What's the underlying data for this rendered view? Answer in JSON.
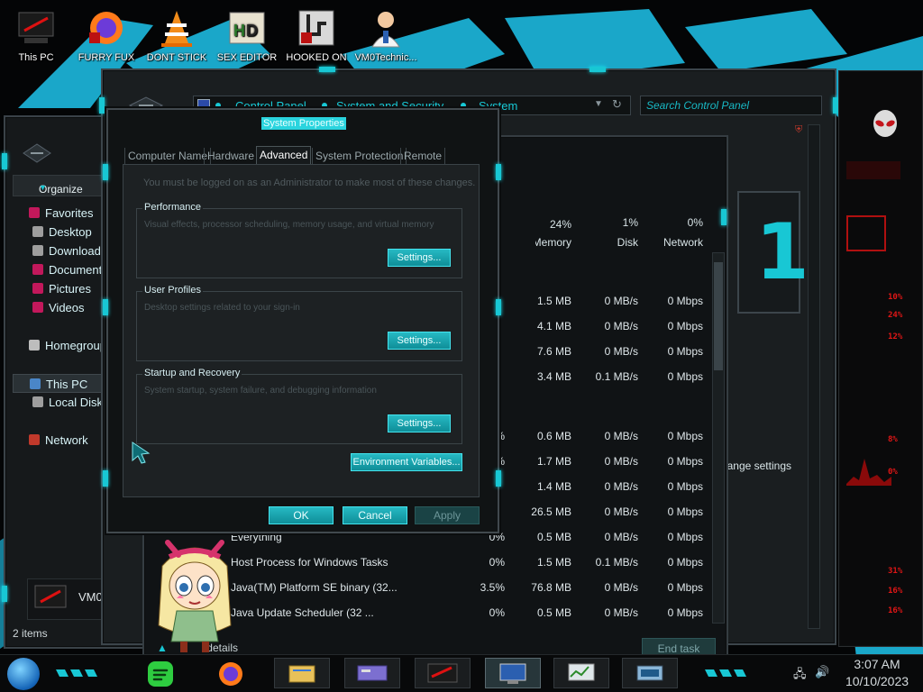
{
  "desktop_icons": [
    {
      "label": "This PC"
    },
    {
      "label": "FURRY FUX"
    },
    {
      "label": "DONT STICK"
    },
    {
      "label": "SEX EDITOR"
    },
    {
      "label": "HOOKED ON"
    },
    {
      "label": "VM0Technic..."
    }
  ],
  "explorer": {
    "organize": "Organize",
    "nav": [
      {
        "label": "Favorites",
        "top": true
      },
      {
        "label": "Desktop"
      },
      {
        "label": "Downloads"
      },
      {
        "label": "Documents"
      },
      {
        "label": "Pictures"
      },
      {
        "label": "Videos"
      },
      {
        "label": "Homegroup",
        "top": true
      },
      {
        "label": "This PC",
        "top": true
      },
      {
        "label": "Local Disk"
      },
      {
        "label": "Network",
        "top": true
      }
    ],
    "vm_label": "VM0",
    "status": "2 items"
  },
  "control_panel": {
    "breadcrumb": [
      "Control Panel",
      "System and Security",
      "System"
    ],
    "search_placeholder": "Search Control Panel",
    "change_settings": "Change settings"
  },
  "task_manager": {
    "headers": {
      "memory_pct": "24%",
      "memory": "Memory",
      "disk_pct": "1%",
      "disk": "Disk",
      "network_pct": "0%",
      "network": "Network"
    },
    "rows": [
      {
        "name": "",
        "cpu": "",
        "memory": "1.5 MB",
        "disk": "0 MB/s",
        "network": "0 Mbps"
      },
      {
        "name": "",
        "cpu": "",
        "memory": "4.1 MB",
        "disk": "0 MB/s",
        "network": "0 Mbps"
      },
      {
        "name": "",
        "cpu": "",
        "memory": "7.6 MB",
        "disk": "0 MB/s",
        "network": "0 Mbps"
      },
      {
        "name": "",
        "cpu": "",
        "memory": "3.4 MB",
        "disk": "0.1 MB/s",
        "network": "0 Mbps"
      },
      {
        "name": "",
        "cpu": "%",
        "memory": "0.6 MB",
        "disk": "0 MB/s",
        "network": "0 Mbps"
      },
      {
        "name": "",
        "cpu": "%",
        "memory": "1.7 MB",
        "disk": "0 MB/s",
        "network": "0 Mbps"
      },
      {
        "name": "",
        "cpu": "",
        "memory": "1.4 MB",
        "disk": "0 MB/s",
        "network": "0 Mbps"
      },
      {
        "name": "",
        "cpu": "",
        "memory": "26.5 MB",
        "disk": "0 MB/s",
        "network": "0 Mbps"
      },
      {
        "name": "Everything",
        "cpu": "0%",
        "memory": "0.5 MB",
        "disk": "0 MB/s",
        "network": "0 Mbps"
      },
      {
        "name": "Host Process for Windows Tasks",
        "cpu": "0%",
        "memory": "1.5 MB",
        "disk": "0.1 MB/s",
        "network": "0 Mbps"
      },
      {
        "name": "Java(TM) Platform SE binary (32...",
        "cpu": "3.5%",
        "memory": "76.8 MB",
        "disk": "0 MB/s",
        "network": "0 Mbps"
      },
      {
        "name": "Java Update Scheduler (32 ...",
        "cpu": "0%",
        "memory": "0.5 MB",
        "disk": "0 MB/s",
        "network": "0 Mbps"
      }
    ],
    "fewer_details": "Fewer details",
    "end_task": "End task"
  },
  "dialog": {
    "title": "System Properties",
    "tabs": [
      "Computer Name",
      "Hardware",
      "Advanced",
      "System Protection",
      "Remote"
    ],
    "active_tab": "Advanced",
    "admin_note": "You must be logged on as an Administrator to make most of these changes.",
    "groups": [
      {
        "title": "Performance",
        "desc": "Visual effects, processor scheduling, memory usage, and virtual memory",
        "button": "Settings..."
      },
      {
        "title": "User Profiles",
        "desc": "Desktop settings related to your sign-in",
        "button": "Settings..."
      },
      {
        "title": "Startup and Recovery",
        "desc": "System startup, system failure, and debugging information",
        "button": "Settings..."
      }
    ],
    "env_button": "Environment Variables...",
    "ok": "OK",
    "cancel": "Cancel",
    "apply": "Apply"
  },
  "alien_panel": {
    "readouts": [
      "10%",
      "24%",
      "12%",
      "8%",
      "0%",
      "31%",
      "16%",
      "16%"
    ]
  },
  "taskbar": {
    "time": "3:07 AM",
    "date": "10/10/2023"
  },
  "colors": {
    "accent": "#18c7d4",
    "alert_red": "#e01616"
  }
}
